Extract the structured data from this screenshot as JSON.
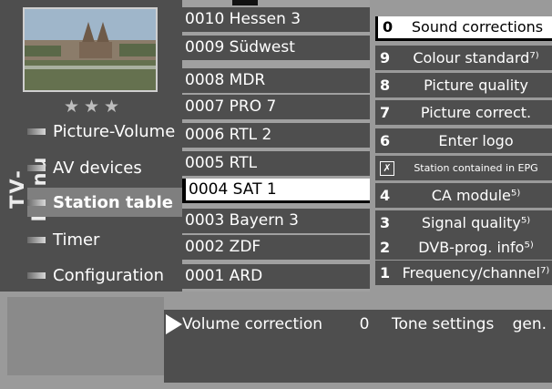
{
  "menu": {
    "title": "TV-Menu",
    "stars": "★★★",
    "items": [
      {
        "label": "Picture-Volume"
      },
      {
        "label": "AV devices"
      },
      {
        "label": "Station table"
      },
      {
        "label": "Timer"
      },
      {
        "label": "Configuration"
      }
    ]
  },
  "stations": [
    {
      "label": "0010 Hessen 3"
    },
    {
      "label": "0009 Südwest"
    },
    {
      "label": "0008 MDR"
    },
    {
      "label": "0007 PRO 7"
    },
    {
      "label": "0006 RTL 2"
    },
    {
      "label": "0005 RTL"
    },
    {
      "label": "0004 SAT 1"
    },
    {
      "label": "0003 Bayern 3"
    },
    {
      "label": "0002 ZDF"
    },
    {
      "label": "0001 ARD"
    }
  ],
  "functions": [
    {
      "num": "0",
      "label": "Sound corrections"
    },
    {
      "num": "9",
      "label": "Colour standard⁷⁾"
    },
    {
      "num": "8",
      "label": "Picture quality"
    },
    {
      "num": "7",
      "label": "Picture correct."
    },
    {
      "num": "6",
      "label": "Enter logo"
    },
    {
      "num": "✗",
      "label": "Station contained in EPG"
    },
    {
      "num": "4",
      "label": "CA module⁵⁾"
    },
    {
      "num": "3",
      "label": "Signal quality⁵⁾"
    },
    {
      "num": "2",
      "label": "DVB-prog. info⁵⁾"
    },
    {
      "num": "1",
      "label": "Frequency/channel⁷⁾"
    }
  ],
  "bottom_bar": {
    "label": "Volume correction",
    "value": "0",
    "tone_label": "Tone settings",
    "mode": "gen."
  }
}
